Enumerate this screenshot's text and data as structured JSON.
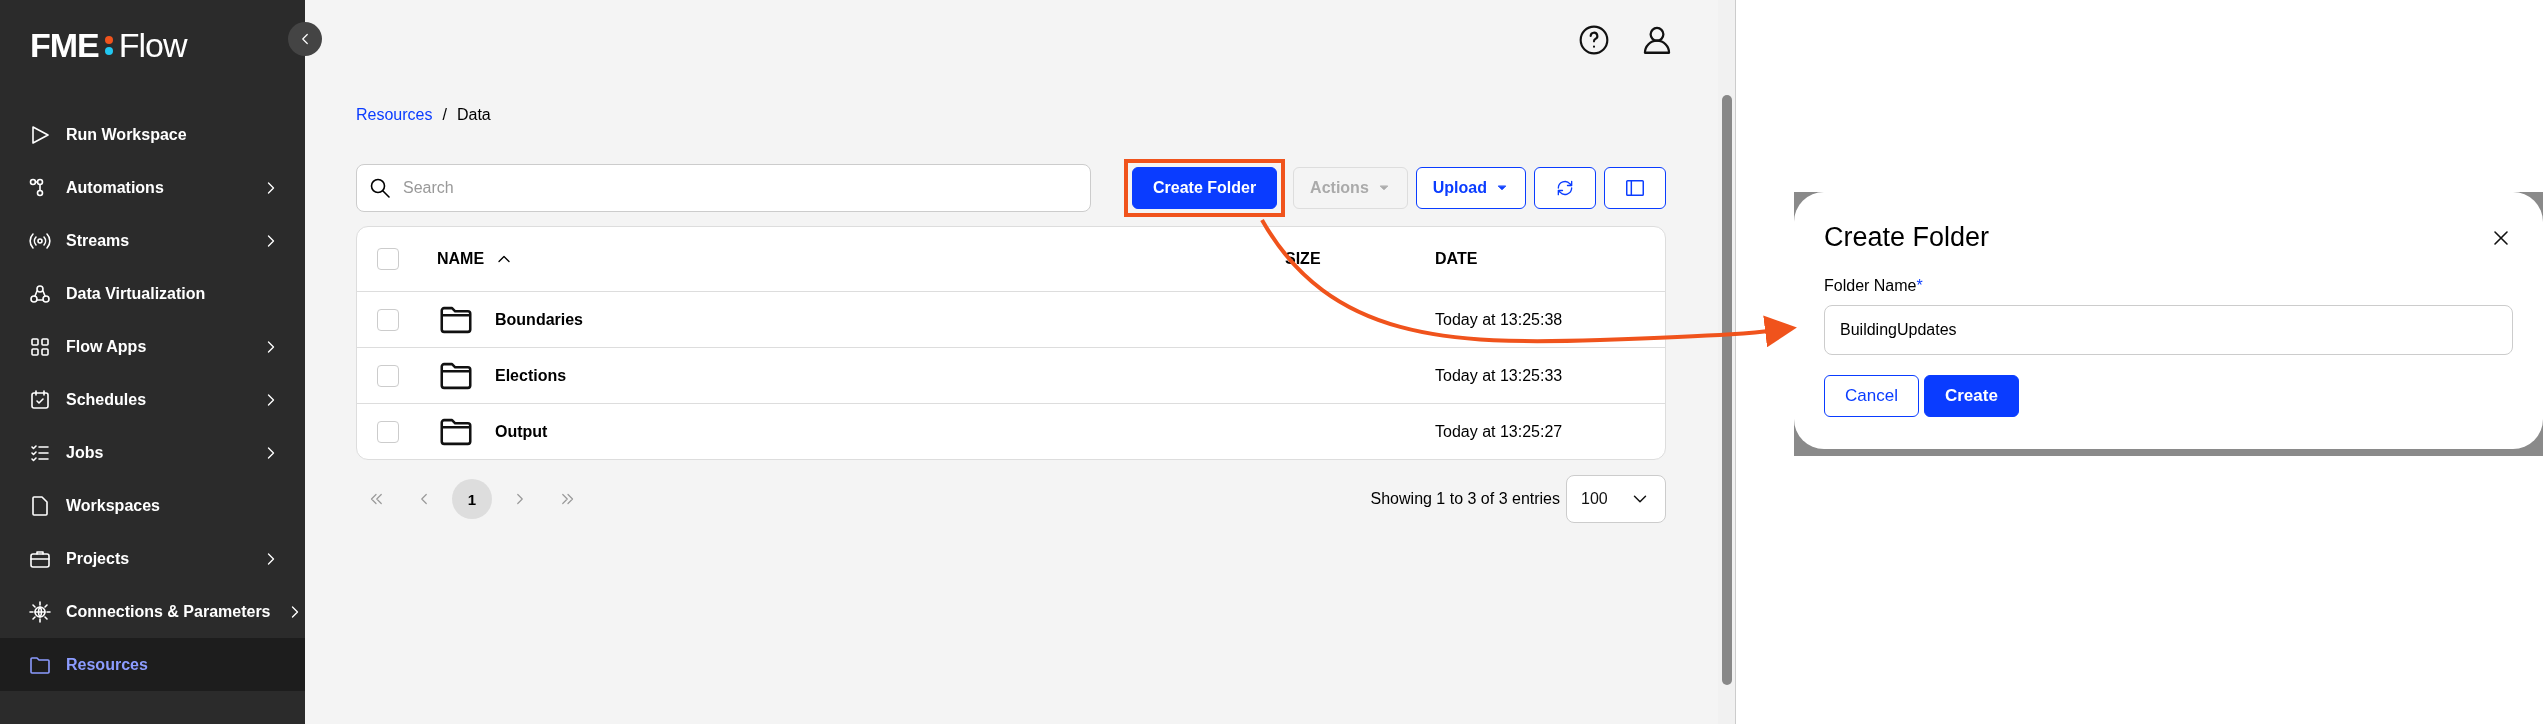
{
  "sidebar": {
    "logo": {
      "left": "FME",
      "right": "Flow"
    },
    "items": [
      {
        "label": "Run Workspace",
        "selected": false,
        "has_submenu": false
      },
      {
        "label": "Automations",
        "selected": false,
        "has_submenu": true
      },
      {
        "label": "Streams",
        "selected": false,
        "has_submenu": true
      },
      {
        "label": "Data Virtualization",
        "selected": false,
        "has_submenu": false
      },
      {
        "label": "Flow Apps",
        "selected": false,
        "has_submenu": true
      },
      {
        "label": "Schedules",
        "selected": false,
        "has_submenu": true
      },
      {
        "label": "Jobs",
        "selected": false,
        "has_submenu": true
      },
      {
        "label": "Workspaces",
        "selected": false,
        "has_submenu": false
      },
      {
        "label": "Projects",
        "selected": false,
        "has_submenu": true
      },
      {
        "label": "Connections & Parameters",
        "selected": false,
        "has_submenu": true
      },
      {
        "label": "Resources",
        "selected": true,
        "has_submenu": false
      }
    ]
  },
  "breadcrumb": [
    {
      "label": "Resources",
      "kind": "link"
    },
    {
      "label": "Data",
      "kind": "current"
    }
  ],
  "breadcrumb_separator": "/",
  "search": {
    "placeholder": "Search"
  },
  "toolbar": [
    {
      "kind": "primary",
      "label": "Create Folder",
      "highlighted": true,
      "disabled": false
    },
    {
      "kind": "dropdown",
      "label": "Actions",
      "highlighted": false,
      "disabled": true
    },
    {
      "kind": "dropdown",
      "label": "Upload",
      "highlighted": false,
      "disabled": false
    },
    {
      "kind": "refresh",
      "highlighted": false,
      "disabled": false
    },
    {
      "kind": "columns",
      "highlighted": false,
      "disabled": false
    }
  ],
  "table": {
    "all_checked": false,
    "columns": [
      {
        "label": "NAME",
        "sorted": true
      },
      {
        "label": "SIZE",
        "sorted": false
      },
      {
        "label": "DATE",
        "sorted": false
      }
    ],
    "rows": [
      {
        "checked": false,
        "name": "Boundaries",
        "date": "Today at 13:25:38"
      },
      {
        "checked": false,
        "name": "Elections",
        "date": "Today at 13:25:33"
      },
      {
        "checked": false,
        "name": "Output",
        "date": "Today at 13:25:27"
      }
    ]
  },
  "pagination": {
    "pages": [
      {
        "label": "1",
        "selected": true
      }
    ],
    "summary": "Showing 1 to 3 of 3 entries",
    "page_size": "100"
  },
  "dialog": {
    "title": "Create Folder",
    "field_label": "Folder Name",
    "required_mark": "*",
    "value": "BuildingUpdates",
    "buttons": [
      {
        "label": "Cancel",
        "kind": "secondary"
      },
      {
        "label": "Create",
        "kind": "primary"
      }
    ]
  }
}
